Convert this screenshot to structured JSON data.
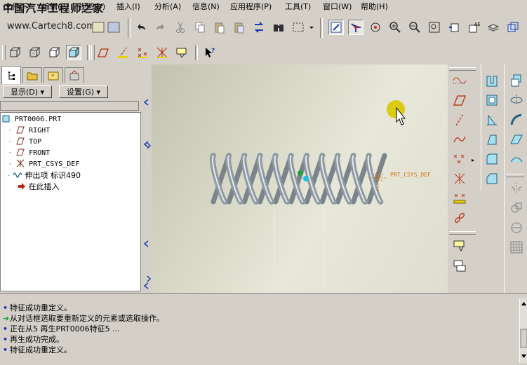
{
  "menu": {
    "file": "文件(F)",
    "edit": "编辑(E)",
    "view": "视图(V)",
    "insert": "插入(I)",
    "analysis": "分析(A)",
    "info": "信息(N)",
    "applications": "应用程序(P)",
    "tools": "工具(T)",
    "window": "窗口(W)",
    "help": "帮助(H)"
  },
  "watermark": {
    "site_name": "中国汽车工程师之家",
    "url": "www.Cartech8.com"
  },
  "panel": {
    "show_button": "显示(D) ▾",
    "settings_button": "设置(G) ▾"
  },
  "tree": {
    "items": [
      {
        "label": "PRT0006.PRT"
      },
      {
        "label": "RIGHT"
      },
      {
        "label": "TOP"
      },
      {
        "label": "FRONT"
      },
      {
        "label": "PRT_CSYS_DEF"
      },
      {
        "label": "伸出项 标识490"
      },
      {
        "label": "在此插入"
      }
    ]
  },
  "viewport": {
    "csys_label": "PRT_CSYS_DEF",
    "spring_coils": 11
  },
  "messages": [
    {
      "text": "特征成功重定义。",
      "icon": "bullet"
    },
    {
      "text": "从对话框选取要重新定义的元素或选取操作。",
      "icon": "arrow"
    },
    {
      "text": "正在从5 再生PRT0006特征5 ...",
      "icon": "bullet"
    },
    {
      "text": "再生成功完成。",
      "icon": "bullet"
    },
    {
      "text": "特征成功重定义。",
      "icon": "bullet"
    }
  ],
  "colors": {
    "window_bg": "#d4d0c8",
    "tree_bg": "#ffffff",
    "spring": "#8f9aa0",
    "accent_blue": "#1c3ca8",
    "cursor_highlight": "#d8c800"
  }
}
